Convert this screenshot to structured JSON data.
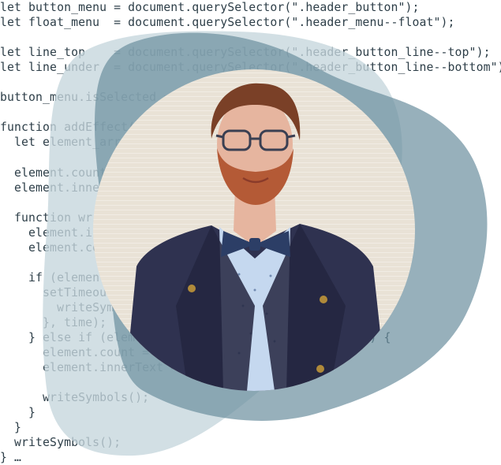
{
  "code_snippet": {
    "lines": [
      "let button_menu = document.querySelector(\".header_button\");",
      "let float_menu  = document.querySelector(\".header_menu--float\");",
      "",
      "let line_top    = document.querySelector(\".header_button_line--top\");",
      "let line_under  = document.querySelector(\".header_button_line--bottom\");",
      "",
      "button_menu.isSelected = false;",
      "",
      "function addEffect(element) {",
      "  let element_array = element.innerText.split(\"\");",
      "",
      "  element.count = 0;",
      "  element.innerText = \"\";",
      "",
      "  function writeSymbols() {",
      "    element.innerText += element_array[element.count];",
      "    element.count++;",
      "",
      "    if (element.count < element_array.length) {",
      "      setTimeout(() => {",
      "        writeSymbols();",
      "      }, time);",
      "    } else if (element.count == element_array.length) {",
      "      element.count = 0;",
      "      element.innerText = \"\";",
      "",
      "      writeSymbols();",
      "    }",
      "  }",
      "  writeSymbols();",
      "} …"
    ]
  },
  "decoration": {
    "blob_back_color": "#c5d6dc",
    "blob_front_color": "#6b8e9e",
    "blob_front_opacity": 0.7
  },
  "portrait": {
    "subject": "man-with-glasses-and-bow-tie",
    "wall_color": "#e9e2d6",
    "skin_color": "#e6b59f",
    "hair_color": "#7a4027",
    "beard_color": "#b45a36",
    "coat_color": "#2f3250",
    "shirt_color": "#c5d8ef",
    "bowtie_color": "#2c3e66",
    "button_color": "#b08a3a"
  }
}
